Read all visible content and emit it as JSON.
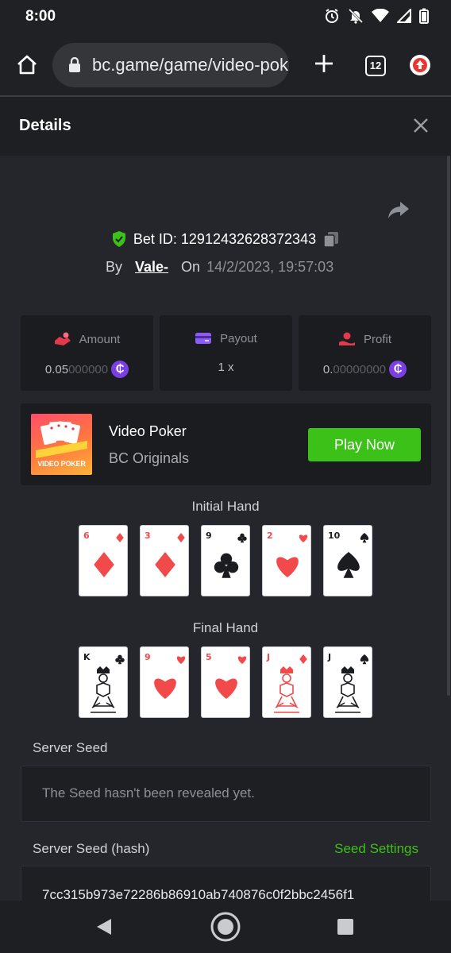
{
  "status": {
    "time": "8:00",
    "icons": [
      "alarm-icon",
      "mute-icon",
      "wifi-icon",
      "signal-icon",
      "battery-icon"
    ]
  },
  "browser": {
    "url": "bc.game/game/video-poker",
    "tab_count": "12",
    "icons": [
      "home-icon",
      "lock-icon",
      "plus-icon",
      "tabs-icon",
      "update-icon"
    ]
  },
  "details": {
    "title": "Details"
  },
  "bet": {
    "id_label": "Bet ID: 12912432628372343",
    "by_label": "By",
    "user": "Vale-",
    "on_label": "On",
    "date": "14/2/2023, 19:57:03"
  },
  "stats": [
    {
      "label": "Amount",
      "value_main": "0.05",
      "value_dim": "000000",
      "icon": "amount-icon"
    },
    {
      "label": "Payout",
      "value_main": "1 x",
      "value_dim": "",
      "icon": "payout-icon"
    },
    {
      "label": "Profit",
      "value_main": "0.",
      "value_dim": "00000000",
      "icon": "profit-icon"
    }
  ],
  "coin_symbol": "₵",
  "game": {
    "name": "Video Poker",
    "provider": "BC Originals",
    "thumb_text": "VIDEO POKER",
    "play_label": "Play Now"
  },
  "initial_hand": {
    "label": "Initial Hand",
    "cards": [
      {
        "rank": "6",
        "suit": "diamond"
      },
      {
        "rank": "3",
        "suit": "diamond"
      },
      {
        "rank": "9",
        "suit": "club"
      },
      {
        "rank": "2",
        "suit": "heart"
      },
      {
        "rank": "10",
        "suit": "spade"
      }
    ]
  },
  "final_hand": {
    "label": "Final Hand",
    "cards": [
      {
        "rank": "K",
        "suit": "club"
      },
      {
        "rank": "9",
        "suit": "heart"
      },
      {
        "rank": "5",
        "suit": "heart"
      },
      {
        "rank": "J",
        "suit": "diamond"
      },
      {
        "rank": "J",
        "suit": "spade"
      }
    ]
  },
  "server_seed": {
    "label": "Server Seed",
    "message": "The Seed hasn't been revealed yet."
  },
  "server_hash": {
    "label": "Server Seed (hash)",
    "settings_label": "Seed Settings",
    "value": "7cc315b973e72286b86910ab740876c0f2bbc2456f1"
  },
  "colors": {
    "accent_green": "#3bc117",
    "coin_purple": "#7b3fe4",
    "red_suit": "#f24a4a",
    "black_suit": "#1b1c1f"
  }
}
